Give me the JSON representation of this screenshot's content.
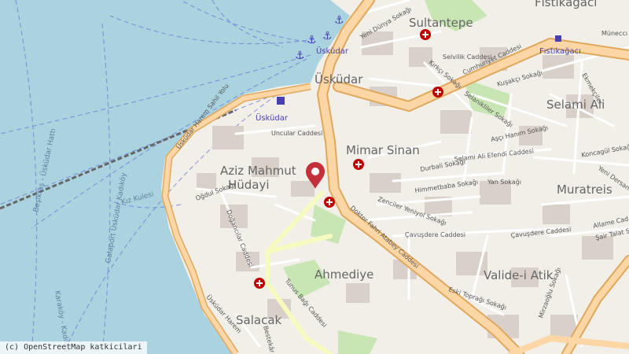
{
  "map": {
    "districts": {
      "uskudar": "Üsküdar",
      "sultantepe": "Sultantepe",
      "fistikagaci": "Fıstıkağacı",
      "selami_ali": "Selami Ali",
      "mimar_sinan": "Mimar Sinan",
      "aziz_mahmut_hudayi_1": "Aziz Mahmut",
      "aziz_mahmut_hudayi_2": "Hüdayi",
      "muratreis": "Muratreis",
      "ahmediye": "Ahmediye",
      "valide_i_atik": "Valide-i Atik",
      "salacak": "Salacak"
    },
    "stations": {
      "uskudar_ferry": "Üsküdar",
      "uskudar_metro": "Üsküdar",
      "fistikagaci_stop": "Fıstıkağacı"
    },
    "streets": {
      "uskudar_harem_sahil_yolu": "Üsküdar Harem Sahil Yolu",
      "cumhuriyet_caddesi": "Cumhuriyet Caddesi",
      "yeni_dunya_sokagi": "Yeni Dünya Sokağı",
      "selvilik_caddesi": "Selvilik Caddesi",
      "kirkci_sokagi": "Kırkçı Sokağı",
      "kusakci_sokagi": "Kuşakçı Sokağı",
      "munecci": "Müneccı",
      "ekmekciler": "Ekmekçiler",
      "selanikliler_sokagi": "Selanikliler Sokağı",
      "asci_hanim_sokagi": "Aşçı Hanım Sokağı",
      "selami_ali_efendi_caddesi": "Selami Ali Efendi Caddesi",
      "uncular_caddesi": "Uncular Caddesi",
      "durbali_sokagi": "Durbali Sokağı",
      "yan_sokagi": "Yan Sokağı",
      "himmetbaba_sokagi": "Himmetbaba Sokağı",
      "zenciler_yeniyol_sokagi": "Zenciler Yeniyol Sokağı",
      "doktor_fahri_atabey_caddesi": "Doktor Fahri Atabey Caddesi",
      "cavusdere_caddesi_1": "Çavuşdere Caddesi",
      "cavusdere_caddesi_2": "Çavuşdere Caddesi",
      "konca_sokagi": "Koncagül Sokağı",
      "yeni_dersane": "Yeni Dersane",
      "allame_caddesi": "Allame Cad",
      "sair_talat": "Şair Talat S",
      "dogancilar_caddesi": "Doğancılar Caddesi",
      "ogdul_sokagi": "Oğdul Sokağı",
      "tunus_bagi_caddesi": "Tunus Bağı Caddesi",
      "eski_toprak_sokagi": "Eski Toprağı Sokağı",
      "mirzaoglu_sokagi": "Mirzaoğlu Sokağı",
      "uskudar_harem_sahil_yolu_2": "Üsküdar Harem",
      "bestekar": "Bestekâr"
    },
    "water_labels": {
      "besiktas_uskudar_hatti": "Beşiktaş - Üsküdar Hattı",
      "galaport_uskudar_kadikoy": "Galaport Üsküdar Kadıköy",
      "kiz_kulesi": "Kız Kulesi",
      "karakoy_kadikoy": "Karaköy - Kadıköy"
    },
    "colors": {
      "water": "#aad3df",
      "land": "#f2efe9",
      "primary_road": "#fcd6a4",
      "road_casing": "#e0a85c",
      "park": "#c8e6b4",
      "hospital": "#c00000",
      "marker": "#c3303a"
    },
    "icons": [
      "hospital-icon",
      "ferry-icon",
      "metro-icon",
      "location-marker-icon"
    ]
  },
  "attribution": "(c) OpenStreetMap katkicilari"
}
